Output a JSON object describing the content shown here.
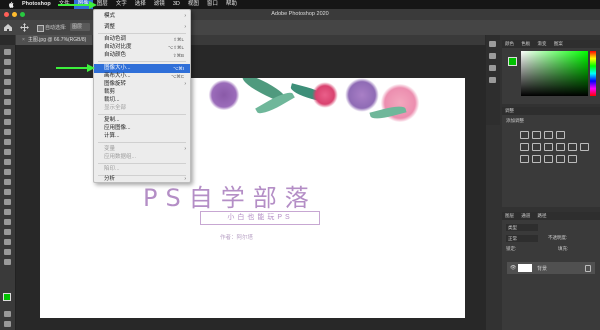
{
  "menubar": {
    "app": "Photoshop",
    "items": [
      "文件",
      "图像",
      "图层",
      "文字",
      "选择",
      "滤镜",
      "3D",
      "视图",
      "窗口",
      "帮助"
    ],
    "active_index": 1
  },
  "window": {
    "title": "Adobe Photoshop 2020"
  },
  "options_bar": {
    "auto_select_label": "自动选择:",
    "layer_label": "图层"
  },
  "document_tab": {
    "label": "主图.jpg @ 66.7%(RGB/8)"
  },
  "image_menu": {
    "items": [
      {
        "label": "模式",
        "shortcut": "",
        "submenu": true,
        "disabled": false
      },
      {
        "label": "调整",
        "shortcut": "",
        "submenu": true,
        "disabled": false
      },
      {
        "label": "自动色调",
        "shortcut": "⇧⌘L",
        "submenu": false,
        "disabled": false
      },
      {
        "label": "自动对比度",
        "shortcut": "⌥⇧⌘L",
        "submenu": false,
        "disabled": false
      },
      {
        "label": "自动颜色",
        "shortcut": "⇧⌘B",
        "submenu": false,
        "disabled": false
      },
      {
        "label": "图像大小...",
        "shortcut": "⌥⌘I",
        "submenu": false,
        "disabled": false,
        "highlighted": true
      },
      {
        "label": "画布大小...",
        "shortcut": "⌥⌘C",
        "submenu": false,
        "disabled": false
      },
      {
        "label": "图像旋转",
        "shortcut": "",
        "submenu": true,
        "disabled": false
      },
      {
        "label": "裁剪",
        "shortcut": "",
        "submenu": false,
        "disabled": false
      },
      {
        "label": "裁切...",
        "shortcut": "",
        "submenu": false,
        "disabled": false
      },
      {
        "label": "显示全部",
        "shortcut": "",
        "submenu": false,
        "disabled": true
      },
      {
        "label": "复制...",
        "shortcut": "",
        "submenu": false,
        "disabled": false
      },
      {
        "label": "应用图像...",
        "shortcut": "",
        "submenu": false,
        "disabled": false
      },
      {
        "label": "计算...",
        "shortcut": "",
        "submenu": false,
        "disabled": false
      },
      {
        "label": "变量",
        "shortcut": "",
        "submenu": true,
        "disabled": true
      },
      {
        "label": "应用数据组...",
        "shortcut": "",
        "submenu": false,
        "disabled": true
      },
      {
        "label": "陷印...",
        "shortcut": "",
        "submenu": false,
        "disabled": true
      },
      {
        "label": "分析",
        "shortcut": "",
        "submenu": true,
        "disabled": false
      }
    ]
  },
  "canvas": {
    "title": "PS自学部落",
    "subtitle": "小白也能玩PS",
    "author": "作者：阿尔塔"
  },
  "panels": {
    "color_tab": "颜色",
    "swatches_tab": "色板",
    "gradient_tab": "渐变",
    "pattern_tab": "图案",
    "adjustments_tab": "调整",
    "adjustments_label": "添加调整",
    "layers_tab": "图层",
    "channels_tab": "通道",
    "paths_tab": "路径",
    "kind_label": "类型",
    "blend_mode": "正常",
    "opacity_label": "不透明度:",
    "lock_label": "锁定:",
    "fill_label": "填充:",
    "background_layer": "背景"
  },
  "colors": {
    "accent_green": "#3df03d",
    "menu_highlight": "#2f6fd8",
    "foreground": "#00c000",
    "title_purple": "#b48ec6"
  }
}
